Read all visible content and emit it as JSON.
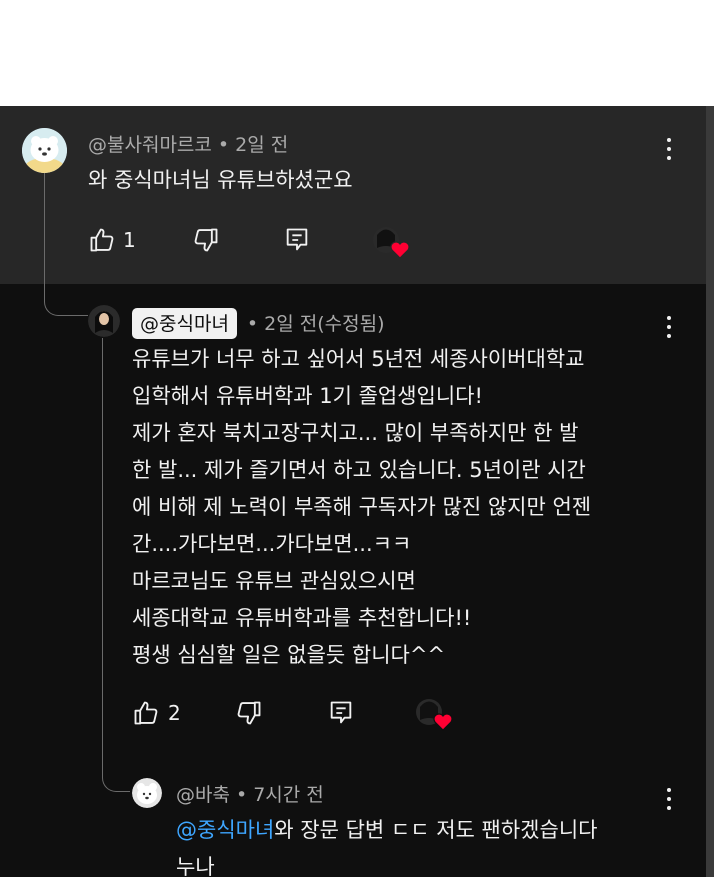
{
  "comments": [
    {
      "handle": "@불사줘마르코",
      "time": "2일 전",
      "text": "와 중식마녀님 유튜브하셨군요",
      "likes": "1"
    },
    {
      "handle": "@중식마녀",
      "time": "2일 전(수정됨)",
      "lines": [
        "유튜브가 너무 하고 싶어서 5년전 세종사이버대학교",
        "입학해서 유튜버학과 1기 졸업생입니다!",
        "제가 혼자 북치고장구치고... 많이 부족하지만 한 발",
        "한 발... 제가 즐기면서 하고 있습니다. 5년이란 시간",
        "에 비해 제 노력이 부족해 구독자가 많진 않지만 언젠",
        "간....가다보면...가다보면...ㅋㅋ",
        "마르코님도 유튜브 관심있으시면",
        "세종대학교 유튜버학과를 추천합니다!!",
        "평생 심심할 일은 없을듯 합니다^^"
      ],
      "likes": "2"
    },
    {
      "handle": "@바축",
      "time": "7시간 전",
      "mention": "@중식마녀",
      "line1_rest": "와 장문 답변 ㄷㄷ 저도 팬하겠습니다",
      "line2": "누나"
    }
  ],
  "colors": {
    "background_top": "#272727",
    "background_bottom": "#0f0f0f",
    "text": "#f1f1f1",
    "meta": "#aaaaaa",
    "mention": "#3ea6ff",
    "heart": "#ff0033"
  },
  "icons": [
    "thumb-up-icon",
    "thumb-down-icon",
    "reply-icon",
    "creator-heart-icon",
    "more-vert-icon"
  ]
}
